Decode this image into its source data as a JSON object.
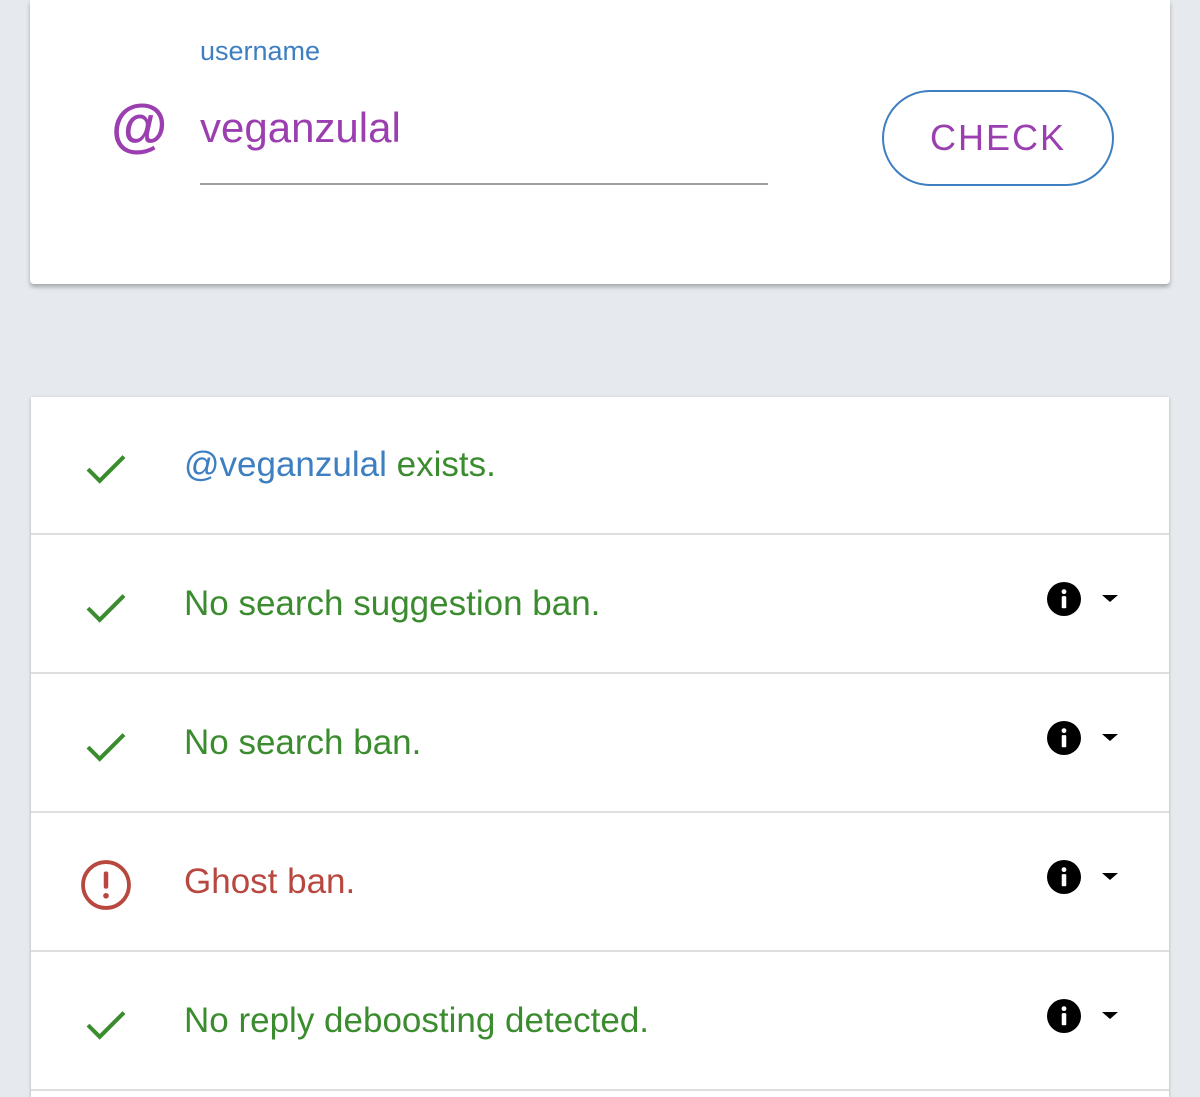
{
  "colors": {
    "accent_purple": "#9b3fb0",
    "link_blue": "#3d7fc1",
    "success_green": "#3b8c2f",
    "error_red": "#b7473f",
    "info_icon": "#000000"
  },
  "search": {
    "label": "username",
    "at_symbol": "@",
    "value": "veganzulal",
    "button_label": "CHECK"
  },
  "results": [
    {
      "status": "ok",
      "icon": "check-icon",
      "handle": "@veganzulal",
      "text": " exists.",
      "has_info": false
    },
    {
      "status": "ok",
      "icon": "check-icon",
      "text": "No search suggestion ban.",
      "has_info": true
    },
    {
      "status": "ok",
      "icon": "check-icon",
      "text": "No search ban.",
      "has_info": true
    },
    {
      "status": "error",
      "icon": "alert-circle-icon",
      "text": "Ghost ban.",
      "has_info": true
    },
    {
      "status": "ok",
      "icon": "check-icon",
      "text": "No reply deboosting detected.",
      "has_info": true
    }
  ]
}
